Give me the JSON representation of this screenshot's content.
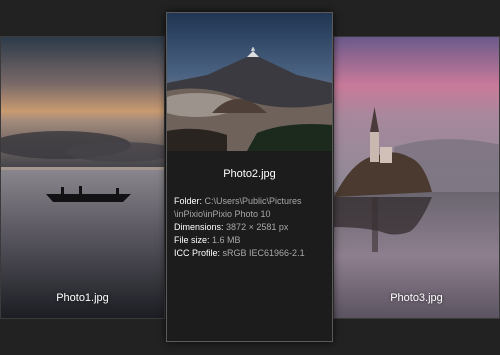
{
  "photos": [
    {
      "filename": "Photo1.jpg"
    },
    {
      "filename": "Photo2.jpg",
      "details": {
        "folder_label": "Folder:",
        "folder_value_line1": "C:\\Users\\Public\\Pictures",
        "folder_value_line2": "\\inPixio\\inPixio Photo 10",
        "dimensions_label": "Dimensions:",
        "dimensions_value": "3872 × 2581 px",
        "filesize_label": "File size:",
        "filesize_value": "1.6 MB",
        "icc_label": "ICC Profile:",
        "icc_value": "sRGB IEC61966-2.1"
      }
    },
    {
      "filename": "Photo3.jpg"
    }
  ],
  "colors": {
    "background": "#222222",
    "label_text": "#ffffff",
    "value_text": "#a8a8a8"
  }
}
